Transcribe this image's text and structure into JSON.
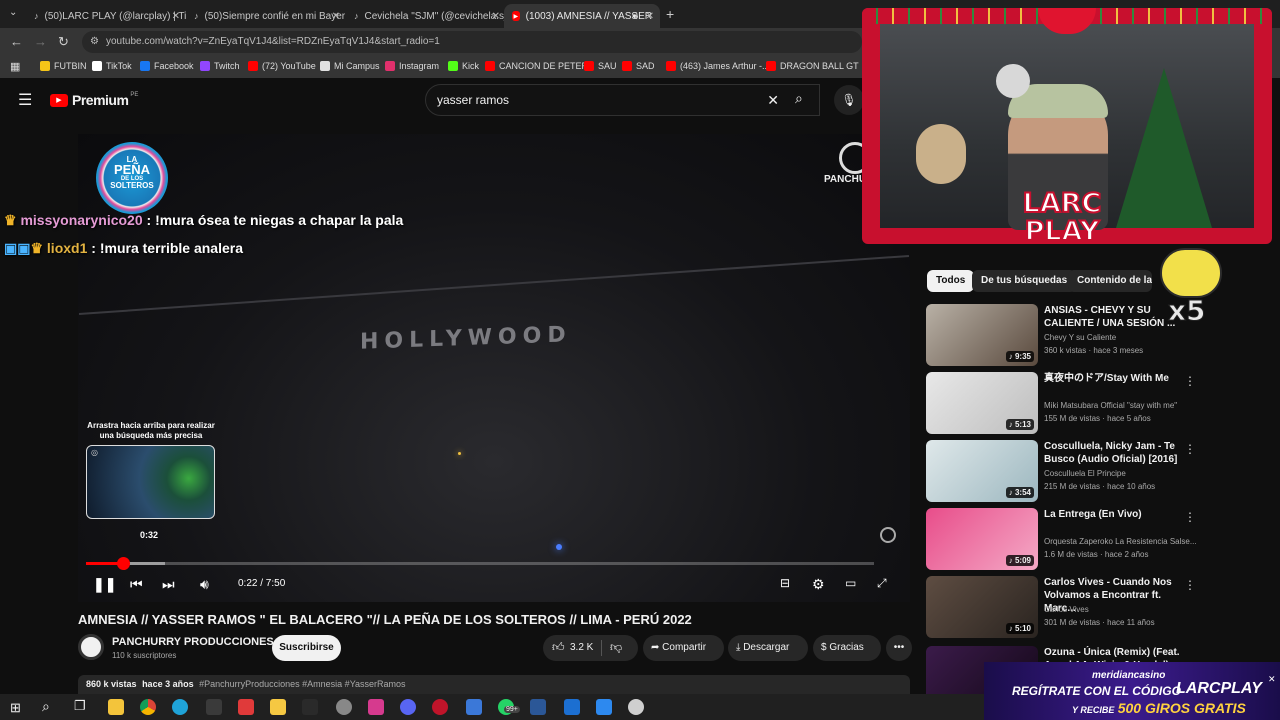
{
  "browser": {
    "tabs": [
      {
        "label": "(50)LARC PLAY (@larcplay) | Tik",
        "icon": "tiktok-icon"
      },
      {
        "label": "(50)Siempre confié en mi Bayer",
        "icon": "tiktok-icon"
      },
      {
        "label": "Cevichela \"SJM\" (@cevichela.sj",
        "icon": "tiktok-icon"
      },
      {
        "label": "(1003) AMNESIA // YASSER",
        "icon": "youtube-icon"
      }
    ],
    "url": "youtube.com/watch?v=ZnEyaTqV1J4&list=RDZnEyaTqV1J4&start_radio=1",
    "bookmarks": [
      {
        "label": "FUTBIN",
        "color": "#f5c518"
      },
      {
        "label": "TikTok",
        "color": "#ffffff"
      },
      {
        "label": "Facebook",
        "color": "#1877f2"
      },
      {
        "label": "Twitch",
        "color": "#9146ff"
      },
      {
        "label": "(72) YouTube",
        "color": "#ff0000"
      },
      {
        "label": "Mi Campus",
        "color": "#e0e0e0"
      },
      {
        "label": "Instagram",
        "color": "#e1306c"
      },
      {
        "label": "Kick",
        "color": "#53fc18"
      },
      {
        "label": "CANCION DE PETER",
        "color": "#ff0000"
      },
      {
        "label": "SAU",
        "color": "#ff0000"
      },
      {
        "label": "SAD",
        "color": "#ff0000"
      },
      {
        "label": "(463) James Arthur -...",
        "color": "#ff0000"
      },
      {
        "label": "DRAGON BALL GT",
        "color": "#ff0000"
      }
    ]
  },
  "youtube": {
    "logo": "Premium",
    "region": "PE",
    "search_query": "yasser ramos"
  },
  "video": {
    "chat": [
      {
        "user": "missyonarynico20",
        "message": ": !mura ósea te niegas a chapar la pala",
        "color": "#e59bd5"
      },
      {
        "user": "lioxd1",
        "message": ": !mura terrible analera",
        "color": "#e3b341"
      }
    ],
    "sign_text": "HOLLYWOOD",
    "channel_watermark": "PANCHURRY",
    "logo_lines": [
      "LA",
      "PEÑA",
      "DE LOS",
      "SOLTEROS"
    ],
    "preview_hint": "Arrastra hacia arriba para realizar una búsqueda más precisa",
    "preview_time": "0:32",
    "time_display": "0:22 / 7:50",
    "progress": 0.047,
    "buffered": 0.1
  },
  "details": {
    "title": "AMNESIA // YASSER RAMOS \" EL BALACERO \"// LA PEÑA DE LOS SOLTEROS // LIMA - PERÚ 2022",
    "channel": "PANCHURRY PRODUCCIONES",
    "subscribers": "110 k suscriptores",
    "subscribe_label": "Suscribirse",
    "likes": "3.2 K",
    "share_label": "Compartir",
    "download_label": "Descargar",
    "thanks_label": "Gracias",
    "views": "860 k vistas",
    "age": "hace 3 años",
    "hashtags": "#PanchurryProducciones #Amnesia #YasserRamos"
  },
  "chips": [
    "Todos",
    "De tus búsquedas",
    "Contenido de la s"
  ],
  "recommendations": [
    {
      "title": "ANSIAS - CHEVY Y SU CALIENTE / UNA SESIÓN ...",
      "channel": "Chevy Y su Caliente",
      "meta": "360 k vistas · hace 3 meses",
      "duration": "9:35",
      "colors": [
        "#b9b1a6",
        "#5a4a3e"
      ]
    },
    {
      "title": "真夜中のドア/Stay With Me",
      "channel": "Miki Matsubara Official \"stay with me\"",
      "meta": "155 M de vistas · hace 5 años",
      "duration": "5:13",
      "colors": [
        "#e8e8e8",
        "#bdbdbd"
      ]
    },
    {
      "title": "Cosculluela, Nicky Jam - Te Busco (Audio Oficial) [2016]",
      "channel": "Cosculluela El Principe",
      "meta": "215 M de vistas · hace 10 años",
      "duration": "3:54",
      "colors": [
        "#dfe8ea",
        "#9cb7bf"
      ]
    },
    {
      "title": "La Entrega (En Vivo)",
      "channel": "Orquesta Zaperoko La Resistencia Salse...",
      "meta": "1.6 M de vistas · hace 2 años",
      "duration": "5:09",
      "colors": [
        "#e84d8a",
        "#f4a9c6"
      ]
    },
    {
      "title": "Carlos Vives - Cuando Nos Volvamos a Encontrar ft. Marc...",
      "channel": "Carlos Vives",
      "meta": "301 M de vistas · hace 11 años",
      "duration": "5:10",
      "colors": [
        "#5e4d42",
        "#2a2420"
      ]
    },
    {
      "title": "Ozuna - Única (Remix) (Feat. Anuel AA, Wisin & Yandel)",
      "channel": "",
      "meta": "",
      "duration": "",
      "colors": [
        "#3b1b4a",
        "#120716"
      ]
    }
  ],
  "stream": {
    "brand_line1": "LARC",
    "brand_line2": "PLAY",
    "multiplier": "x5",
    "casino_name": "meridiancasino",
    "casino_line1": "REGÍTRATE CON EL CÓDIGO",
    "casino_code": "LARCPLAY",
    "casino_line2_prefix": "Y RECIBE",
    "casino_line2_bold": "500 GIROS GRATIS"
  },
  "taskbar": {
    "badge": "99+"
  }
}
